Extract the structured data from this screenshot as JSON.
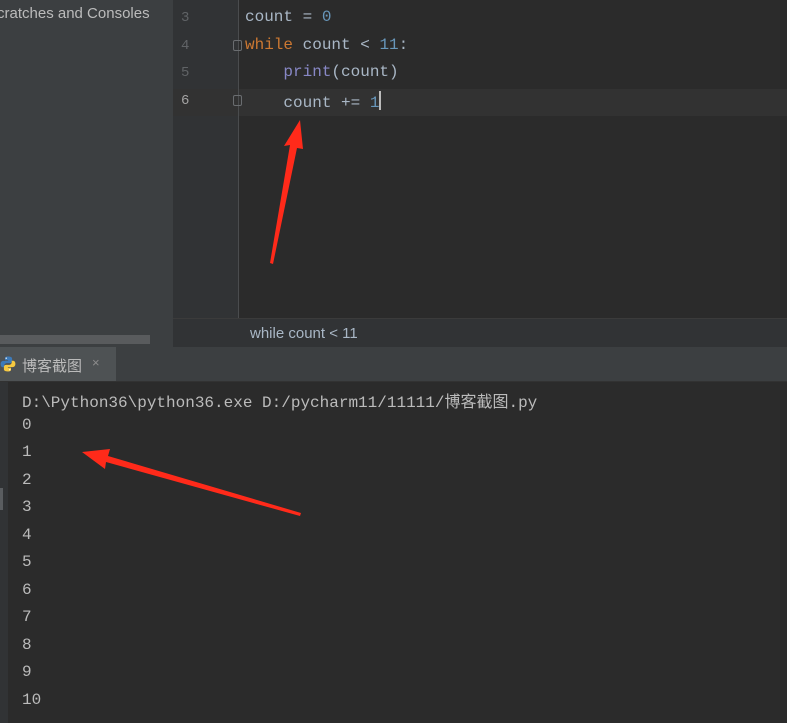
{
  "project_panel": {
    "item": "cratches and Consoles"
  },
  "editor": {
    "lines": [
      {
        "number": "3",
        "tokens": [
          {
            "t": "count = ",
            "c": "plain"
          },
          {
            "t": "0",
            "c": "num"
          }
        ]
      },
      {
        "number": "4",
        "tokens": [
          {
            "t": "while",
            "c": "kw"
          },
          {
            "t": " count < ",
            "c": "plain"
          },
          {
            "t": "11",
            "c": "num"
          },
          {
            "t": ":",
            "c": "plain"
          }
        ]
      },
      {
        "number": "5",
        "tokens": [
          {
            "t": "    ",
            "c": "plain"
          },
          {
            "t": "print",
            "c": "bi"
          },
          {
            "t": "(count)",
            "c": "plain"
          }
        ]
      },
      {
        "number": "6",
        "tokens": [
          {
            "t": "    count += ",
            "c": "plain"
          },
          {
            "t": "1",
            "c": "num"
          }
        ]
      }
    ],
    "active_line": "6",
    "breadcrumb": "while count < 11"
  },
  "run_panel": {
    "tab_label": "博客截图",
    "tab_close": "×",
    "output": [
      "D:\\Python36\\python36.exe D:/pycharm11/11111/博客截图.py",
      "0",
      "1",
      "2",
      "3",
      "4",
      "5",
      "6",
      "7",
      "8",
      "9",
      "10"
    ]
  },
  "annotations": {
    "arrow_color": "#ff2a1a"
  },
  "icons": {
    "run_tab": "python-icon",
    "fold": "fold-marker-icon"
  }
}
